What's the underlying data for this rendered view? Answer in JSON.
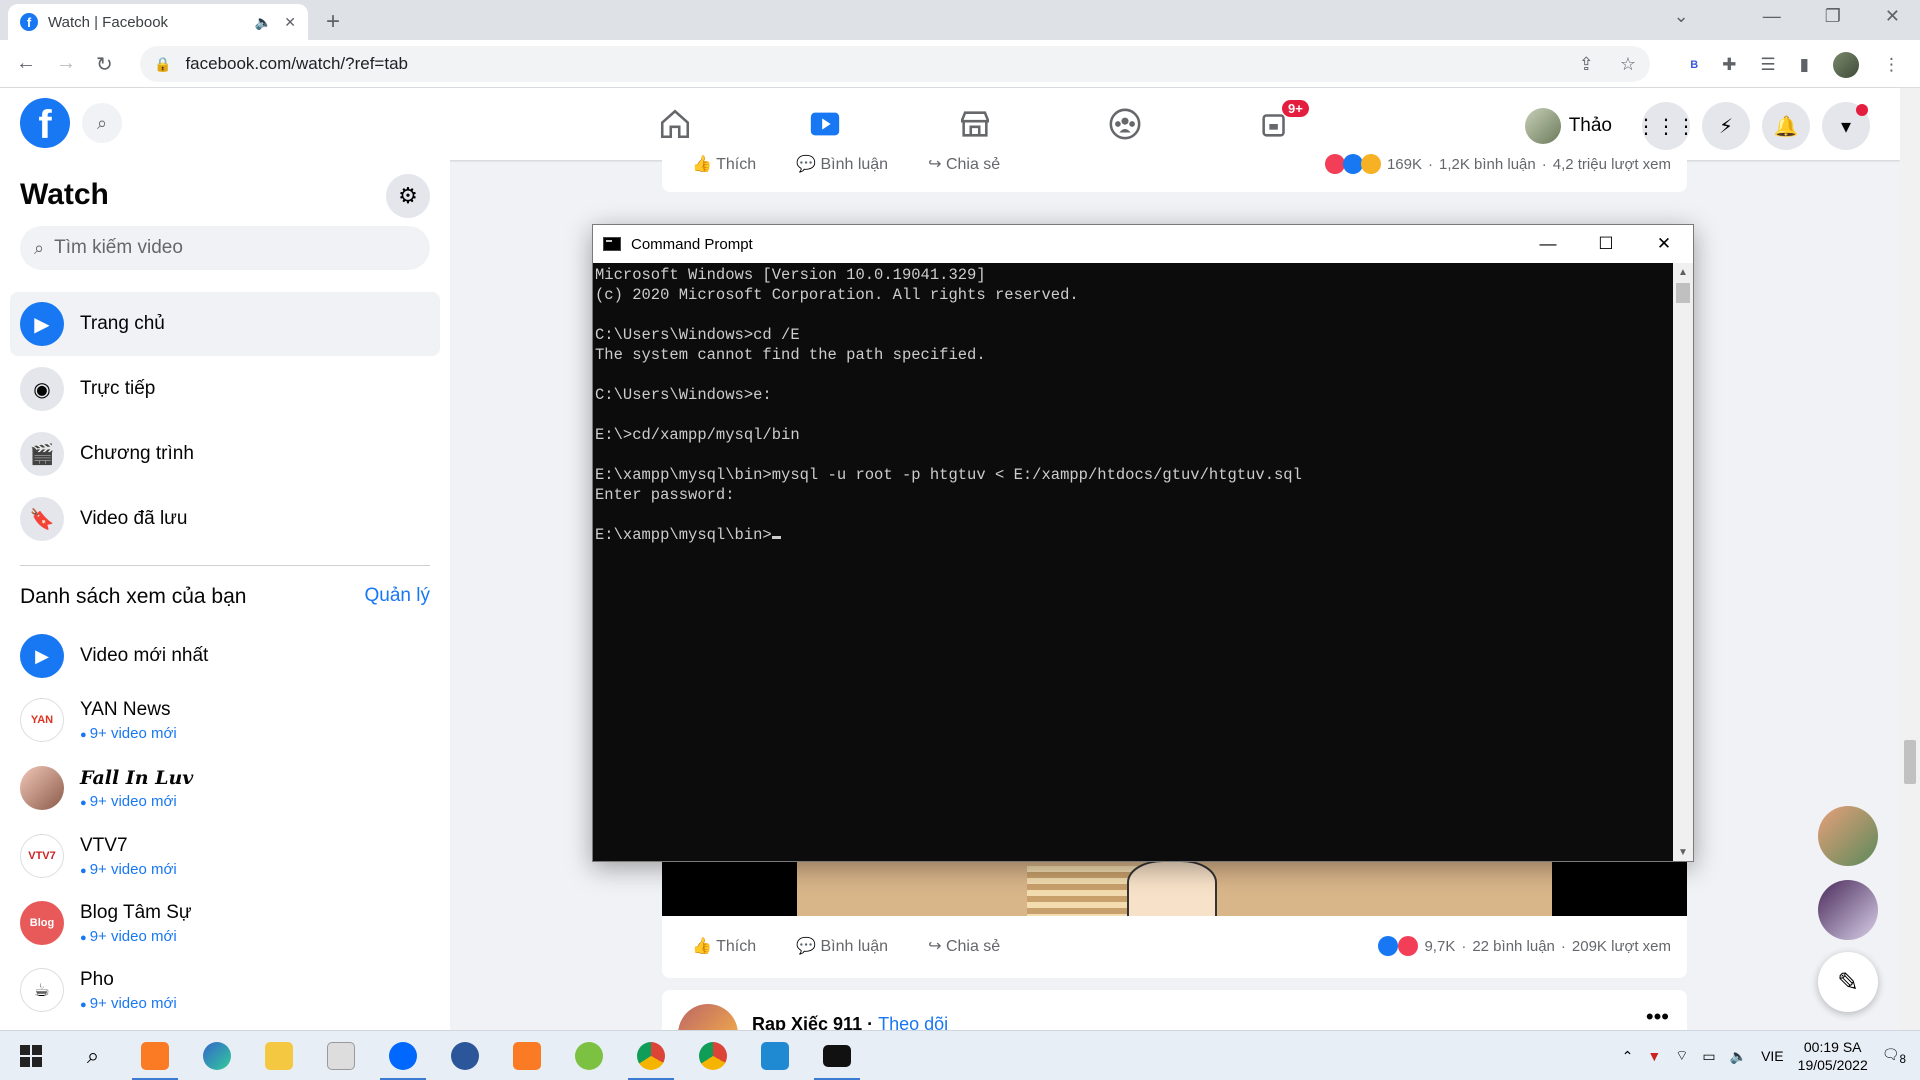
{
  "browser": {
    "tab_title": "Watch | Facebook",
    "new_tab": "+",
    "url": "facebook.com/watch/?ref=tab",
    "extension_letter": "B"
  },
  "fb": {
    "profile_name": "Thảo",
    "notifications_badge": "9+",
    "brand_color": "#1877f2"
  },
  "sidebar": {
    "title": "Watch",
    "search_placeholder": "Tìm kiếm video",
    "items": [
      {
        "label": "Trang chủ",
        "icon": "play-screen-icon"
      },
      {
        "label": "Trực tiếp",
        "icon": "live-camera-icon"
      },
      {
        "label": "Chương trình",
        "icon": "clapperboard-icon"
      },
      {
        "label": "Video đã lưu",
        "icon": "bookmark-icon"
      }
    ],
    "watchlist_heading": "Danh sách xem của bạn",
    "manage_label": "Quản lý",
    "newest_label": "Video mới nhất",
    "watchlist": [
      {
        "name": "YAN News",
        "sub": "9+ video mới"
      },
      {
        "name": "Fall In Luv",
        "sub": "9+ video mới"
      },
      {
        "name": "VTV7",
        "sub": "9+ video mới"
      },
      {
        "name": "Blog Tâm Sự",
        "sub": "9+ video mới"
      },
      {
        "name": "Pho",
        "sub": "9+ video mới"
      }
    ]
  },
  "feed": {
    "like": "Thích",
    "comment": "Bình luận",
    "share": "Chia sẻ",
    "post1_stats": {
      "reactions": "169K",
      "comments": "1,2K bình luận",
      "views": "4,2 triệu lượt xem"
    },
    "post2_stats": {
      "reactions": "9,7K",
      "comments": "22 bình luận",
      "views": "209K lượt xem"
    },
    "next_post_author": "Rap Xiếc 911",
    "next_post_follow": "Theo dõi",
    "separator": "·"
  },
  "cmd": {
    "title": "Command Prompt",
    "lines": [
      "Microsoft Windows [Version 10.0.19041.329]",
      "(c) 2020 Microsoft Corporation. All rights reserved.",
      "",
      "C:\\Users\\Windows>cd /E",
      "The system cannot find the path specified.",
      "",
      "C:\\Users\\Windows>e:",
      "",
      "E:\\>cd/xampp/mysql/bin",
      "",
      "E:\\xampp\\mysql\\bin>mysql -u root -p htgtuv < E:/xampp/htdocs/gtuv/htgtuv.sql",
      "Enter password:",
      "",
      "E:\\xampp\\mysql\\bin>"
    ]
  },
  "taskbar": {
    "lang": "VIE",
    "time": "00:19 SA",
    "date": "19/05/2022",
    "notif_count": "8",
    "apps": [
      "start-icon",
      "search-icon",
      "xampp-icon",
      "edge-icon",
      "file-explorer-icon",
      "app-icon",
      "zalo-icon",
      "app-icon",
      "xampp-icon",
      "app-icon",
      "chrome-icon",
      "chrome-icon",
      "vscode-icon",
      "cmd-icon"
    ]
  }
}
